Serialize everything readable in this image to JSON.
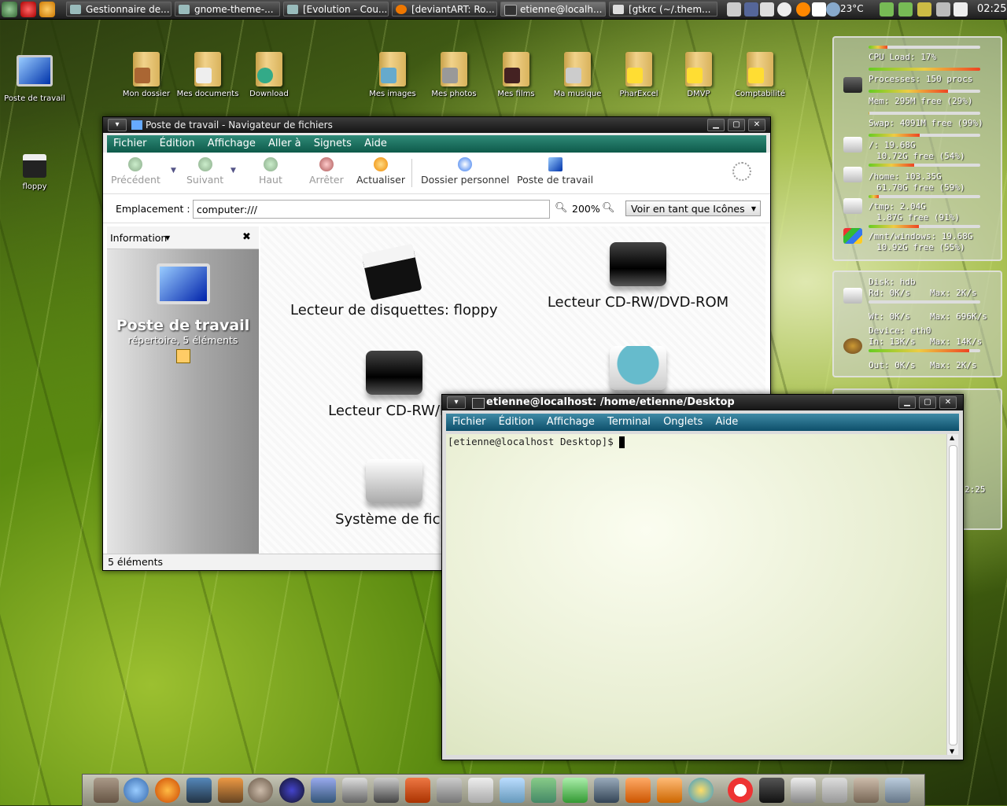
{
  "top_panel": {
    "tasks": [
      {
        "label": "Gestionnaire de..."
      },
      {
        "label": "gnome-theme-..."
      },
      {
        "label": "[Evolution - Cou..."
      },
      {
        "label": "[deviantART: Ro..."
      },
      {
        "label": "etienne@localh..."
      },
      {
        "label": "[gtkrc (~/.them..."
      }
    ],
    "temperature": "23°C",
    "clock": "02:25"
  },
  "desktop_icons": [
    {
      "label": "Poste de travail"
    },
    {
      "label": "Mon dossier"
    },
    {
      "label": "Mes documents"
    },
    {
      "label": "Download"
    },
    {
      "label": "Mes images"
    },
    {
      "label": "Mes photos"
    },
    {
      "label": "Mes films"
    },
    {
      "label": "Ma musique"
    },
    {
      "label": "PharExcel"
    },
    {
      "label": "DMVP"
    },
    {
      "label": "Comptabilité"
    },
    {
      "label": "floppy"
    }
  ],
  "conky_system": {
    "cpu": "CPU Load: 17%",
    "cpu_fraction": 0.17,
    "processes": "Processes: 150 procs",
    "mem": "Mem: 295M free (29%)",
    "mem_fraction": 0.71,
    "swap": "Swap: 4091M free (99%)",
    "swap_fraction": 0.01,
    "root": "/: 19.68G",
    "root_free": "10.72G free (54%)",
    "root_fraction": 0.46,
    "home": "/home: 103.35G",
    "home_free": "61.70G free (59%)",
    "home_fraction": 0.41,
    "tmp": "/tmp: 2.04G",
    "tmp_free": "1.87G free (91%)",
    "tmp_fraction": 0.09,
    "windows": "/mnt/windows: 19.68G",
    "windows_free": "10.92G free (55%)",
    "windows_fraction": 0.45
  },
  "conky_io": {
    "disk": "Disk: hdb",
    "rd": "Rd: 0K/s",
    "rd_max": "Max: 2K/s",
    "wt": "Wt: 0K/s",
    "wt_max": "Max: 696K/s",
    "device": "Device: eth0",
    "in": "In: 13K/s",
    "in_max": "Max: 14K/s",
    "out": "Out: 0K/s",
    "out_max": "Max: 2K/s"
  },
  "conky_clock_partial": "2:25",
  "file_manager": {
    "title": "Poste de travail - Navigateur de fichiers",
    "menu": [
      "Fichier",
      "Édition",
      "Affichage",
      "Aller à",
      "Signets",
      "Aide"
    ],
    "toolbar": {
      "back": "Précédent",
      "forward": "Suivant",
      "up": "Haut",
      "stop": "Arrêter",
      "reload": "Actualiser",
      "home": "Dossier personnel",
      "computer": "Poste de travail"
    },
    "location_label": "Emplacement :",
    "location_value": "computer:///",
    "zoom": "200%",
    "view_mode": "Voir en tant que Icônes",
    "sidebar_mode": "Information",
    "sidebar_title": "Poste de travail",
    "sidebar_subtitle": "répertoire, 5 éléments",
    "items": [
      {
        "label": "Lecteur de disquettes: floppy"
      },
      {
        "label": "Lecteur CD-RW/DVD-ROM"
      },
      {
        "label": "Lecteur CD-RW/DV"
      },
      {
        "label": ""
      },
      {
        "label": "Système de fichi"
      }
    ],
    "status": "5 éléments"
  },
  "terminal": {
    "title": "etienne@localhost: /home/etienne/Desktop",
    "menu": [
      "Fichier",
      "Édition",
      "Affichage",
      "Terminal",
      "Onglets",
      "Aide"
    ],
    "prompt": "[etienne@localhost Desktop]$ "
  },
  "colors": {
    "menubar_accent": "#1f7563",
    "terminal_menubar": "#2b6f88"
  }
}
